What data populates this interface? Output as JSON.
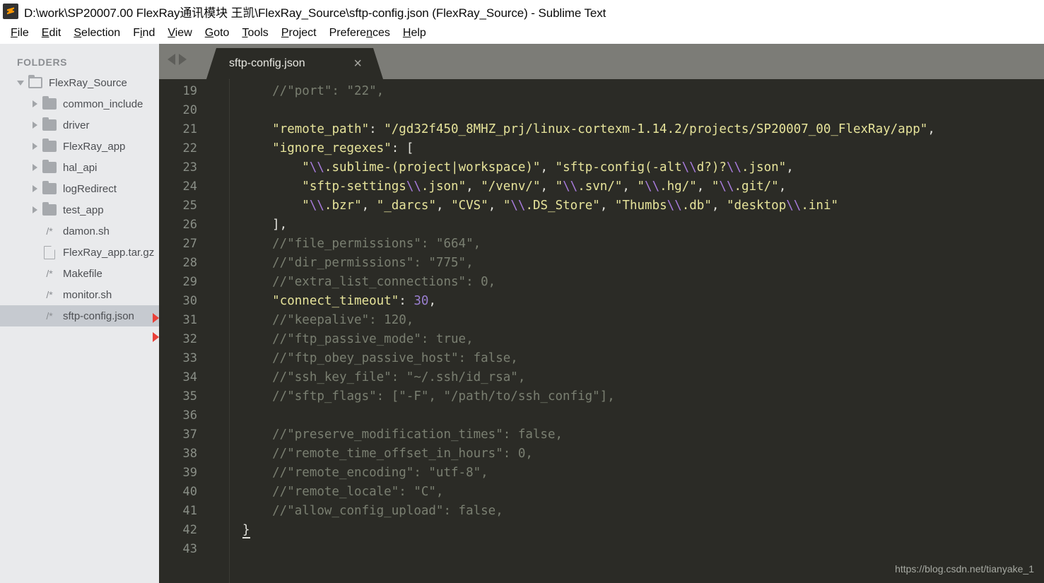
{
  "window": {
    "title": "D:\\work\\SP20007.00 FlexRay通讯模块 王凯\\FlexRay_Source\\sftp-config.json (FlexRay_Source) - Sublime Text",
    "logo_letter": "S"
  },
  "menubar": {
    "items": [
      {
        "label": "File",
        "accel": "F",
        "rest": "ile"
      },
      {
        "label": "Edit",
        "accel": "E",
        "rest": "dit"
      },
      {
        "label": "Selection",
        "accel": "S",
        "rest": "election"
      },
      {
        "label": "Find",
        "pre": "F",
        "accel": "i",
        "rest": "nd"
      },
      {
        "label": "View",
        "accel": "V",
        "rest": "iew"
      },
      {
        "label": "Goto",
        "accel": "G",
        "rest": "oto"
      },
      {
        "label": "Tools",
        "accel": "T",
        "rest": "ools"
      },
      {
        "label": "Project",
        "accel": "P",
        "rest": "roject"
      },
      {
        "label": "Preferences",
        "pre": "Prefere",
        "accel": "n",
        "rest": "ces"
      },
      {
        "label": "Help",
        "accel": "H",
        "rest": "elp"
      }
    ]
  },
  "sidebar": {
    "header": "FOLDERS",
    "items": [
      {
        "label": "FlexRay_Source",
        "icon": "folder-open-icon",
        "arrow": "down",
        "level": 0,
        "selected": false
      },
      {
        "label": "common_include",
        "icon": "folder-icon",
        "arrow": "right",
        "level": 1,
        "selected": false
      },
      {
        "label": "driver",
        "icon": "folder-icon",
        "arrow": "right",
        "level": 1,
        "selected": false
      },
      {
        "label": "FlexRay_app",
        "icon": "folder-icon",
        "arrow": "right",
        "level": 1,
        "selected": false
      },
      {
        "label": "hal_api",
        "icon": "folder-icon",
        "arrow": "right",
        "level": 1,
        "selected": false
      },
      {
        "label": "logRedirect",
        "icon": "folder-icon",
        "arrow": "right",
        "level": 1,
        "selected": false
      },
      {
        "label": "test_app",
        "icon": "folder-icon",
        "arrow": "right",
        "level": 1,
        "selected": false
      },
      {
        "label": "damon.sh",
        "icon": "script-icon",
        "arrow": "none",
        "level": 1,
        "selected": false
      },
      {
        "label": "FlexRay_app.tar.gz",
        "icon": "file-icon",
        "arrow": "none",
        "level": 1,
        "selected": false
      },
      {
        "label": "Makefile",
        "icon": "script-icon",
        "arrow": "none",
        "level": 1,
        "selected": false
      },
      {
        "label": "monitor.sh",
        "icon": "script-icon",
        "arrow": "none",
        "level": 1,
        "selected": false
      },
      {
        "label": "sftp-config.json",
        "icon": "script-icon",
        "arrow": "none",
        "level": 1,
        "selected": true
      }
    ],
    "script_icon_glyph": "/*"
  },
  "tabbar": {
    "nav_back": "nav-back-arrow",
    "nav_forward": "nav-forward-arrow",
    "tab_label": "sftp-config.json",
    "close_glyph": "×"
  },
  "editor": {
    "first_line_number": 19,
    "lines": [
      {
        "n": 19,
        "spans": [
          {
            "t": "    //\"port\": \"22\",",
            "c": "cm"
          }
        ]
      },
      {
        "n": 20,
        "spans": [
          {
            "t": "",
            "c": "pun"
          }
        ]
      },
      {
        "n": 21,
        "spans": [
          {
            "t": "    ",
            "c": "pun"
          },
          {
            "t": "\"remote_path\"",
            "c": "key"
          },
          {
            "t": ": ",
            "c": "pun"
          },
          {
            "t": "\"/gd32f450_8MHZ_prj/linux-cortexm-1.14.2/projects/SP20007_00_FlexRay/app\"",
            "c": "str"
          },
          {
            "t": ",",
            "c": "pun"
          }
        ]
      },
      {
        "n": 22,
        "spans": [
          {
            "t": "    ",
            "c": "pun"
          },
          {
            "t": "\"ignore_regexes\"",
            "c": "key"
          },
          {
            "t": ": [",
            "c": "pun"
          }
        ]
      },
      {
        "n": 23,
        "spans": [
          {
            "t": "        ",
            "c": "pun"
          },
          {
            "t": "\"",
            "c": "str"
          },
          {
            "t": "\\\\",
            "c": "esc"
          },
          {
            "t": ".sublime-(project|workspace)\"",
            "c": "str"
          },
          {
            "t": ", ",
            "c": "pun"
          },
          {
            "t": "\"sftp-config(-alt",
            "c": "str"
          },
          {
            "t": "\\\\",
            "c": "esc"
          },
          {
            "t": "d?)?",
            "c": "str"
          },
          {
            "t": "\\\\",
            "c": "esc"
          },
          {
            "t": ".json\"",
            "c": "str"
          },
          {
            "t": ",",
            "c": "pun"
          }
        ]
      },
      {
        "n": 24,
        "spans": [
          {
            "t": "        ",
            "c": "pun"
          },
          {
            "t": "\"sftp-settings",
            "c": "str"
          },
          {
            "t": "\\\\",
            "c": "esc"
          },
          {
            "t": ".json\"",
            "c": "str"
          },
          {
            "t": ", ",
            "c": "pun"
          },
          {
            "t": "\"/venv/\"",
            "c": "str"
          },
          {
            "t": ", ",
            "c": "pun"
          },
          {
            "t": "\"",
            "c": "str"
          },
          {
            "t": "\\\\",
            "c": "esc"
          },
          {
            "t": ".svn/\"",
            "c": "str"
          },
          {
            "t": ", ",
            "c": "pun"
          },
          {
            "t": "\"",
            "c": "str"
          },
          {
            "t": "\\\\",
            "c": "esc"
          },
          {
            "t": ".hg/\"",
            "c": "str"
          },
          {
            "t": ", ",
            "c": "pun"
          },
          {
            "t": "\"",
            "c": "str"
          },
          {
            "t": "\\\\",
            "c": "esc"
          },
          {
            "t": ".git/\"",
            "c": "str"
          },
          {
            "t": ",",
            "c": "pun"
          }
        ]
      },
      {
        "n": 25,
        "spans": [
          {
            "t": "        ",
            "c": "pun"
          },
          {
            "t": "\"",
            "c": "str"
          },
          {
            "t": "\\\\",
            "c": "esc"
          },
          {
            "t": ".bzr\"",
            "c": "str"
          },
          {
            "t": ", ",
            "c": "pun"
          },
          {
            "t": "\"_darcs\"",
            "c": "str"
          },
          {
            "t": ", ",
            "c": "pun"
          },
          {
            "t": "\"CVS\"",
            "c": "str"
          },
          {
            "t": ", ",
            "c": "pun"
          },
          {
            "t": "\"",
            "c": "str"
          },
          {
            "t": "\\\\",
            "c": "esc"
          },
          {
            "t": ".DS_Store\"",
            "c": "str"
          },
          {
            "t": ", ",
            "c": "pun"
          },
          {
            "t": "\"Thumbs",
            "c": "str"
          },
          {
            "t": "\\\\",
            "c": "esc"
          },
          {
            "t": ".db\"",
            "c": "str"
          },
          {
            "t": ", ",
            "c": "pun"
          },
          {
            "t": "\"desktop",
            "c": "str"
          },
          {
            "t": "\\\\",
            "c": "esc"
          },
          {
            "t": ".ini\"",
            "c": "str"
          }
        ]
      },
      {
        "n": 26,
        "spans": [
          {
            "t": "    ],",
            "c": "pun"
          }
        ]
      },
      {
        "n": 27,
        "spans": [
          {
            "t": "    //\"file_permissions\": \"664\",",
            "c": "cm"
          }
        ]
      },
      {
        "n": 28,
        "spans": [
          {
            "t": "    //\"dir_permissions\": \"775\",",
            "c": "cm"
          }
        ]
      },
      {
        "n": 29,
        "spans": [
          {
            "t": "    //\"extra_list_connections\": 0,",
            "c": "cm"
          }
        ]
      },
      {
        "n": 30,
        "spans": [
          {
            "t": "    ",
            "c": "pun"
          },
          {
            "t": "\"connect_timeout\"",
            "c": "key"
          },
          {
            "t": ": ",
            "c": "pun"
          },
          {
            "t": "30",
            "c": "num"
          },
          {
            "t": ",",
            "c": "pun"
          }
        ]
      },
      {
        "n": 31,
        "spans": [
          {
            "t": "    //\"keepalive\": 120,",
            "c": "cm"
          }
        ]
      },
      {
        "n": 32,
        "spans": [
          {
            "t": "    //\"ftp_passive_mode\": true,",
            "c": "cm"
          }
        ]
      },
      {
        "n": 33,
        "spans": [
          {
            "t": "    //\"ftp_obey_passive_host\": false,",
            "c": "cm"
          }
        ]
      },
      {
        "n": 34,
        "spans": [
          {
            "t": "    //\"ssh_key_file\": \"~/.ssh/id_rsa\",",
            "c": "cm"
          }
        ]
      },
      {
        "n": 35,
        "spans": [
          {
            "t": "    //\"sftp_flags\": [\"-F\", \"/path/to/ssh_config\"],",
            "c": "cm"
          }
        ]
      },
      {
        "n": 36,
        "spans": [
          {
            "t": "",
            "c": "pun"
          }
        ]
      },
      {
        "n": 37,
        "spans": [
          {
            "t": "    //\"preserve_modification_times\": false,",
            "c": "cm"
          }
        ]
      },
      {
        "n": 38,
        "spans": [
          {
            "t": "    //\"remote_time_offset_in_hours\": 0,",
            "c": "cm"
          }
        ]
      },
      {
        "n": 39,
        "spans": [
          {
            "t": "    //\"remote_encoding\": \"utf-8\",",
            "c": "cm"
          }
        ]
      },
      {
        "n": 40,
        "spans": [
          {
            "t": "    //\"remote_locale\": \"C\",",
            "c": "cm"
          }
        ]
      },
      {
        "n": 41,
        "spans": [
          {
            "t": "    //\"allow_config_upload\": false,",
            "c": "cm"
          }
        ]
      },
      {
        "n": 42,
        "spans": [
          {
            "t": "}",
            "c": "brc"
          }
        ]
      },
      {
        "n": 43,
        "spans": [
          {
            "t": "",
            "c": "pun"
          }
        ]
      }
    ]
  },
  "watermark": "https://blog.csdn.net/tianyake_1",
  "colors": {
    "editor_bg": "#2b2b26",
    "sidebar_bg": "#e9eaec",
    "sidebar_selected": "#c6cad0",
    "tabbar_bg": "#7c7c77",
    "string": "#e6e39a",
    "comment": "#7a7f71",
    "number": "#9a7fd0",
    "escape": "#a77bdb",
    "marker_red": "#e8413a",
    "logo_orange": "#ff9800"
  }
}
